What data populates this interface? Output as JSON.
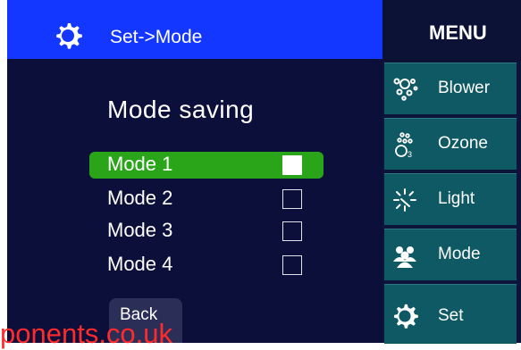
{
  "header": {
    "title": "Set->Mode",
    "icon": "gear-icon"
  },
  "main": {
    "heading": "Mode saving",
    "modes": [
      {
        "label": "Mode 1",
        "checked": true
      },
      {
        "label": "Mode 2",
        "checked": false
      },
      {
        "label": "Mode 3",
        "checked": false
      },
      {
        "label": "Mode 4",
        "checked": false
      }
    ],
    "back_label": "Back"
  },
  "menu": {
    "title": "MENU",
    "items": [
      {
        "label": "Blower",
        "icon": "blower-bubbles-icon"
      },
      {
        "label": "Ozone",
        "icon": "ozone-o3-icon"
      },
      {
        "label": "Light",
        "icon": "light-icon"
      },
      {
        "label": "Mode",
        "icon": "users-icon"
      },
      {
        "label": "Set",
        "icon": "gear-icon"
      }
    ]
  },
  "watermark": "ponents.co.uk",
  "colors": {
    "header_blue": "#1437ff",
    "panel_dark": "#0b0f3a",
    "selected_green": "#2aa51a",
    "menu_teal": "#0f5964"
  }
}
